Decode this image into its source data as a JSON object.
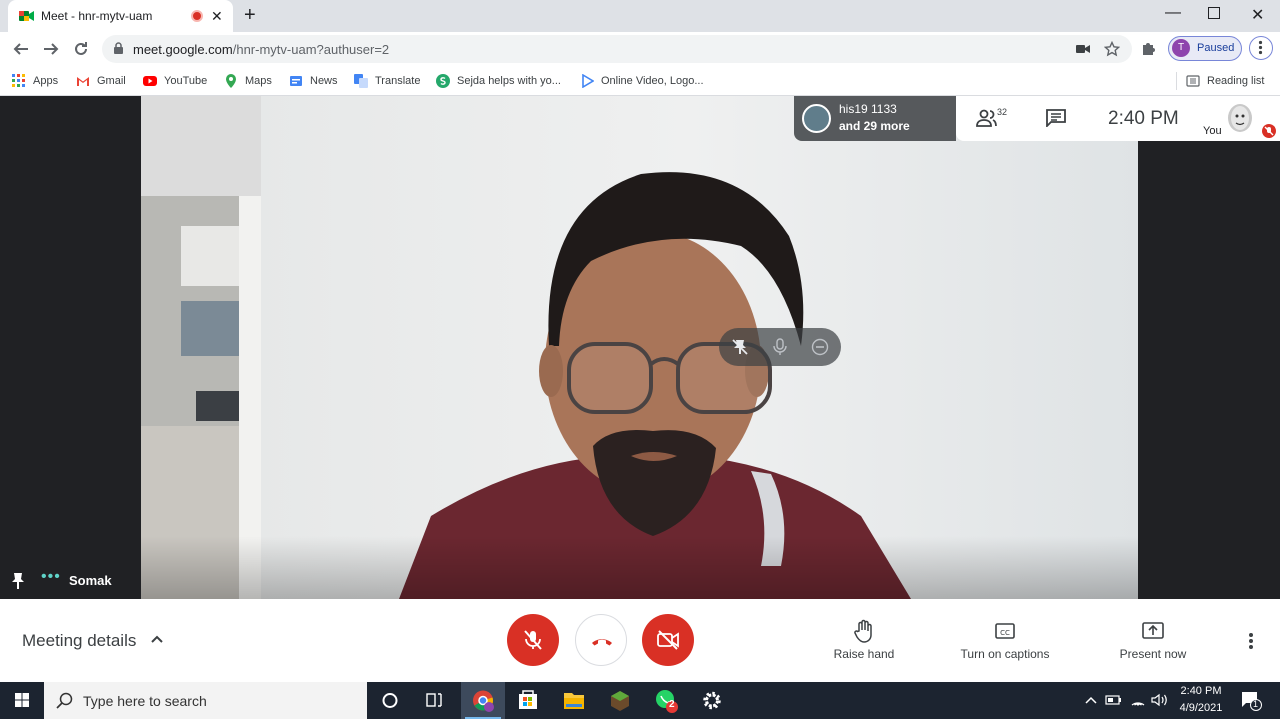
{
  "browser": {
    "tab": {
      "title": "Meet - hnr-mytv-uam",
      "close_glyph": "✕"
    },
    "new_tab_glyph": "+",
    "window": {
      "minimize_glyph": "—",
      "close_glyph": "✕"
    },
    "url": {
      "host": "meet.google.com",
      "path": "/hnr-mytv-uam?authuser=2"
    },
    "profile": {
      "initial": "T",
      "label": "Paused"
    }
  },
  "bookmarks": [
    {
      "label": "Apps",
      "icon": "apps-grid-icon"
    },
    {
      "label": "Gmail",
      "icon": "gmail-icon"
    },
    {
      "label": "YouTube",
      "icon": "youtube-icon"
    },
    {
      "label": "Maps",
      "icon": "maps-icon"
    },
    {
      "label": "News",
      "icon": "news-icon"
    },
    {
      "label": "Translate",
      "icon": "translate-icon"
    },
    {
      "label": "Sejda helps with yo...",
      "icon": "sejda-icon"
    },
    {
      "label": "Online Video, Logo...",
      "icon": "play-icon"
    }
  ],
  "reading_list": "Reading list",
  "meet": {
    "participant_name": "Somak",
    "name_dots": "•••",
    "people_preview": {
      "line1": "his19 1133",
      "line2": "and 29 more"
    },
    "people_count": "32",
    "clock": "2:40  PM",
    "self_label": "You",
    "meeting_details": "Meeting details",
    "controls": {
      "raise_hand": "Raise hand",
      "captions": "Turn on captions",
      "present": "Present now"
    }
  },
  "taskbar": {
    "search_placeholder": "Type here to search",
    "time": "2:40 PM",
    "date": "4/9/2021",
    "whatsapp_badge": "2",
    "notification_count": "1"
  },
  "colors": {
    "danger": "#d93025",
    "meet_bg": "#202124",
    "accent": "#1a73e8"
  }
}
